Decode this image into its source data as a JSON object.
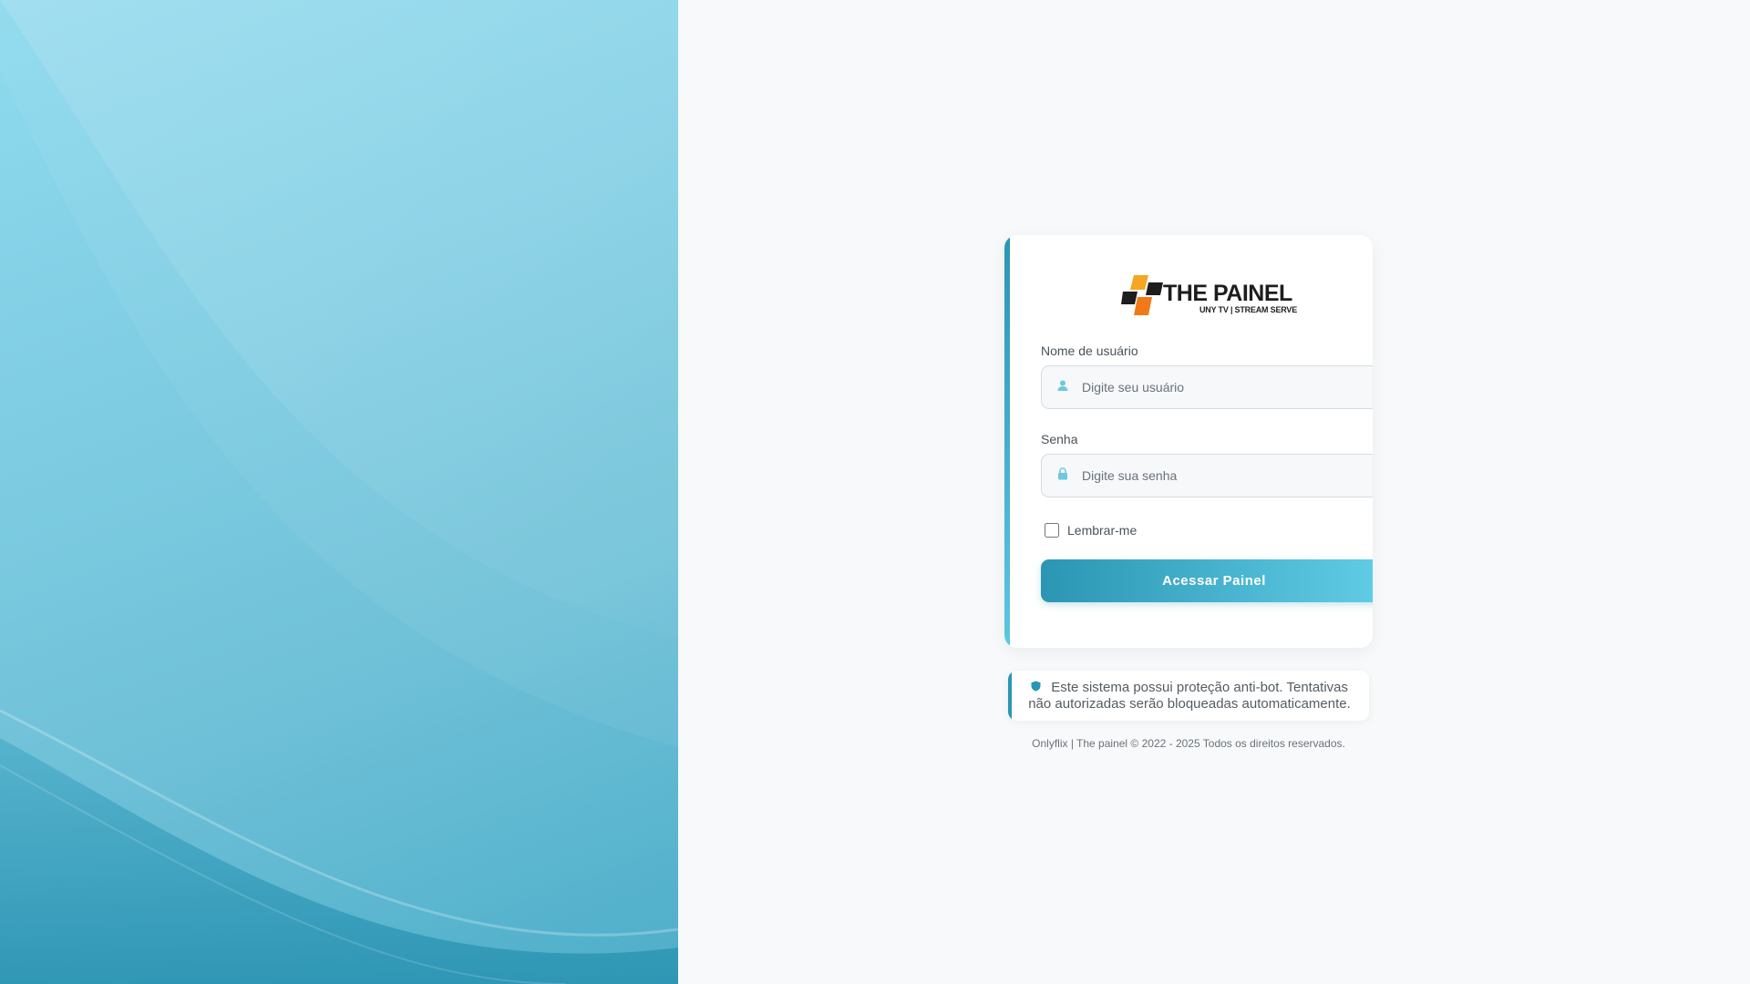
{
  "login": {
    "logo_title": "THE PAINEL",
    "logo_subtitle": "UNY TV | STREAM SERVE",
    "username_label": "Nome de usuário",
    "username_placeholder": "Digite seu usuário",
    "username_value": "",
    "username_icon": "user-icon",
    "password_label": "Senha",
    "password_placeholder": "Digite sua senha",
    "password_value": "",
    "password_icon": "lock-icon",
    "remember_label": "Lembrar-me",
    "remember_checked": false,
    "submit_label": "Acessar Painel"
  },
  "notice": {
    "icon": "shield-icon",
    "text": "Este sistema possui proteção anti-bot. Tentativas não autorizadas serão bloqueadas automaticamente."
  },
  "footer": {
    "text": "Onlyflix | The painel © 2022 - 2025 Todos os direitos reservados."
  },
  "colors": {
    "accent": "#2a96b3",
    "accent_light": "#62cde6",
    "logo_orange": "#f28a1e",
    "logo_dark": "#1d1d1d"
  }
}
